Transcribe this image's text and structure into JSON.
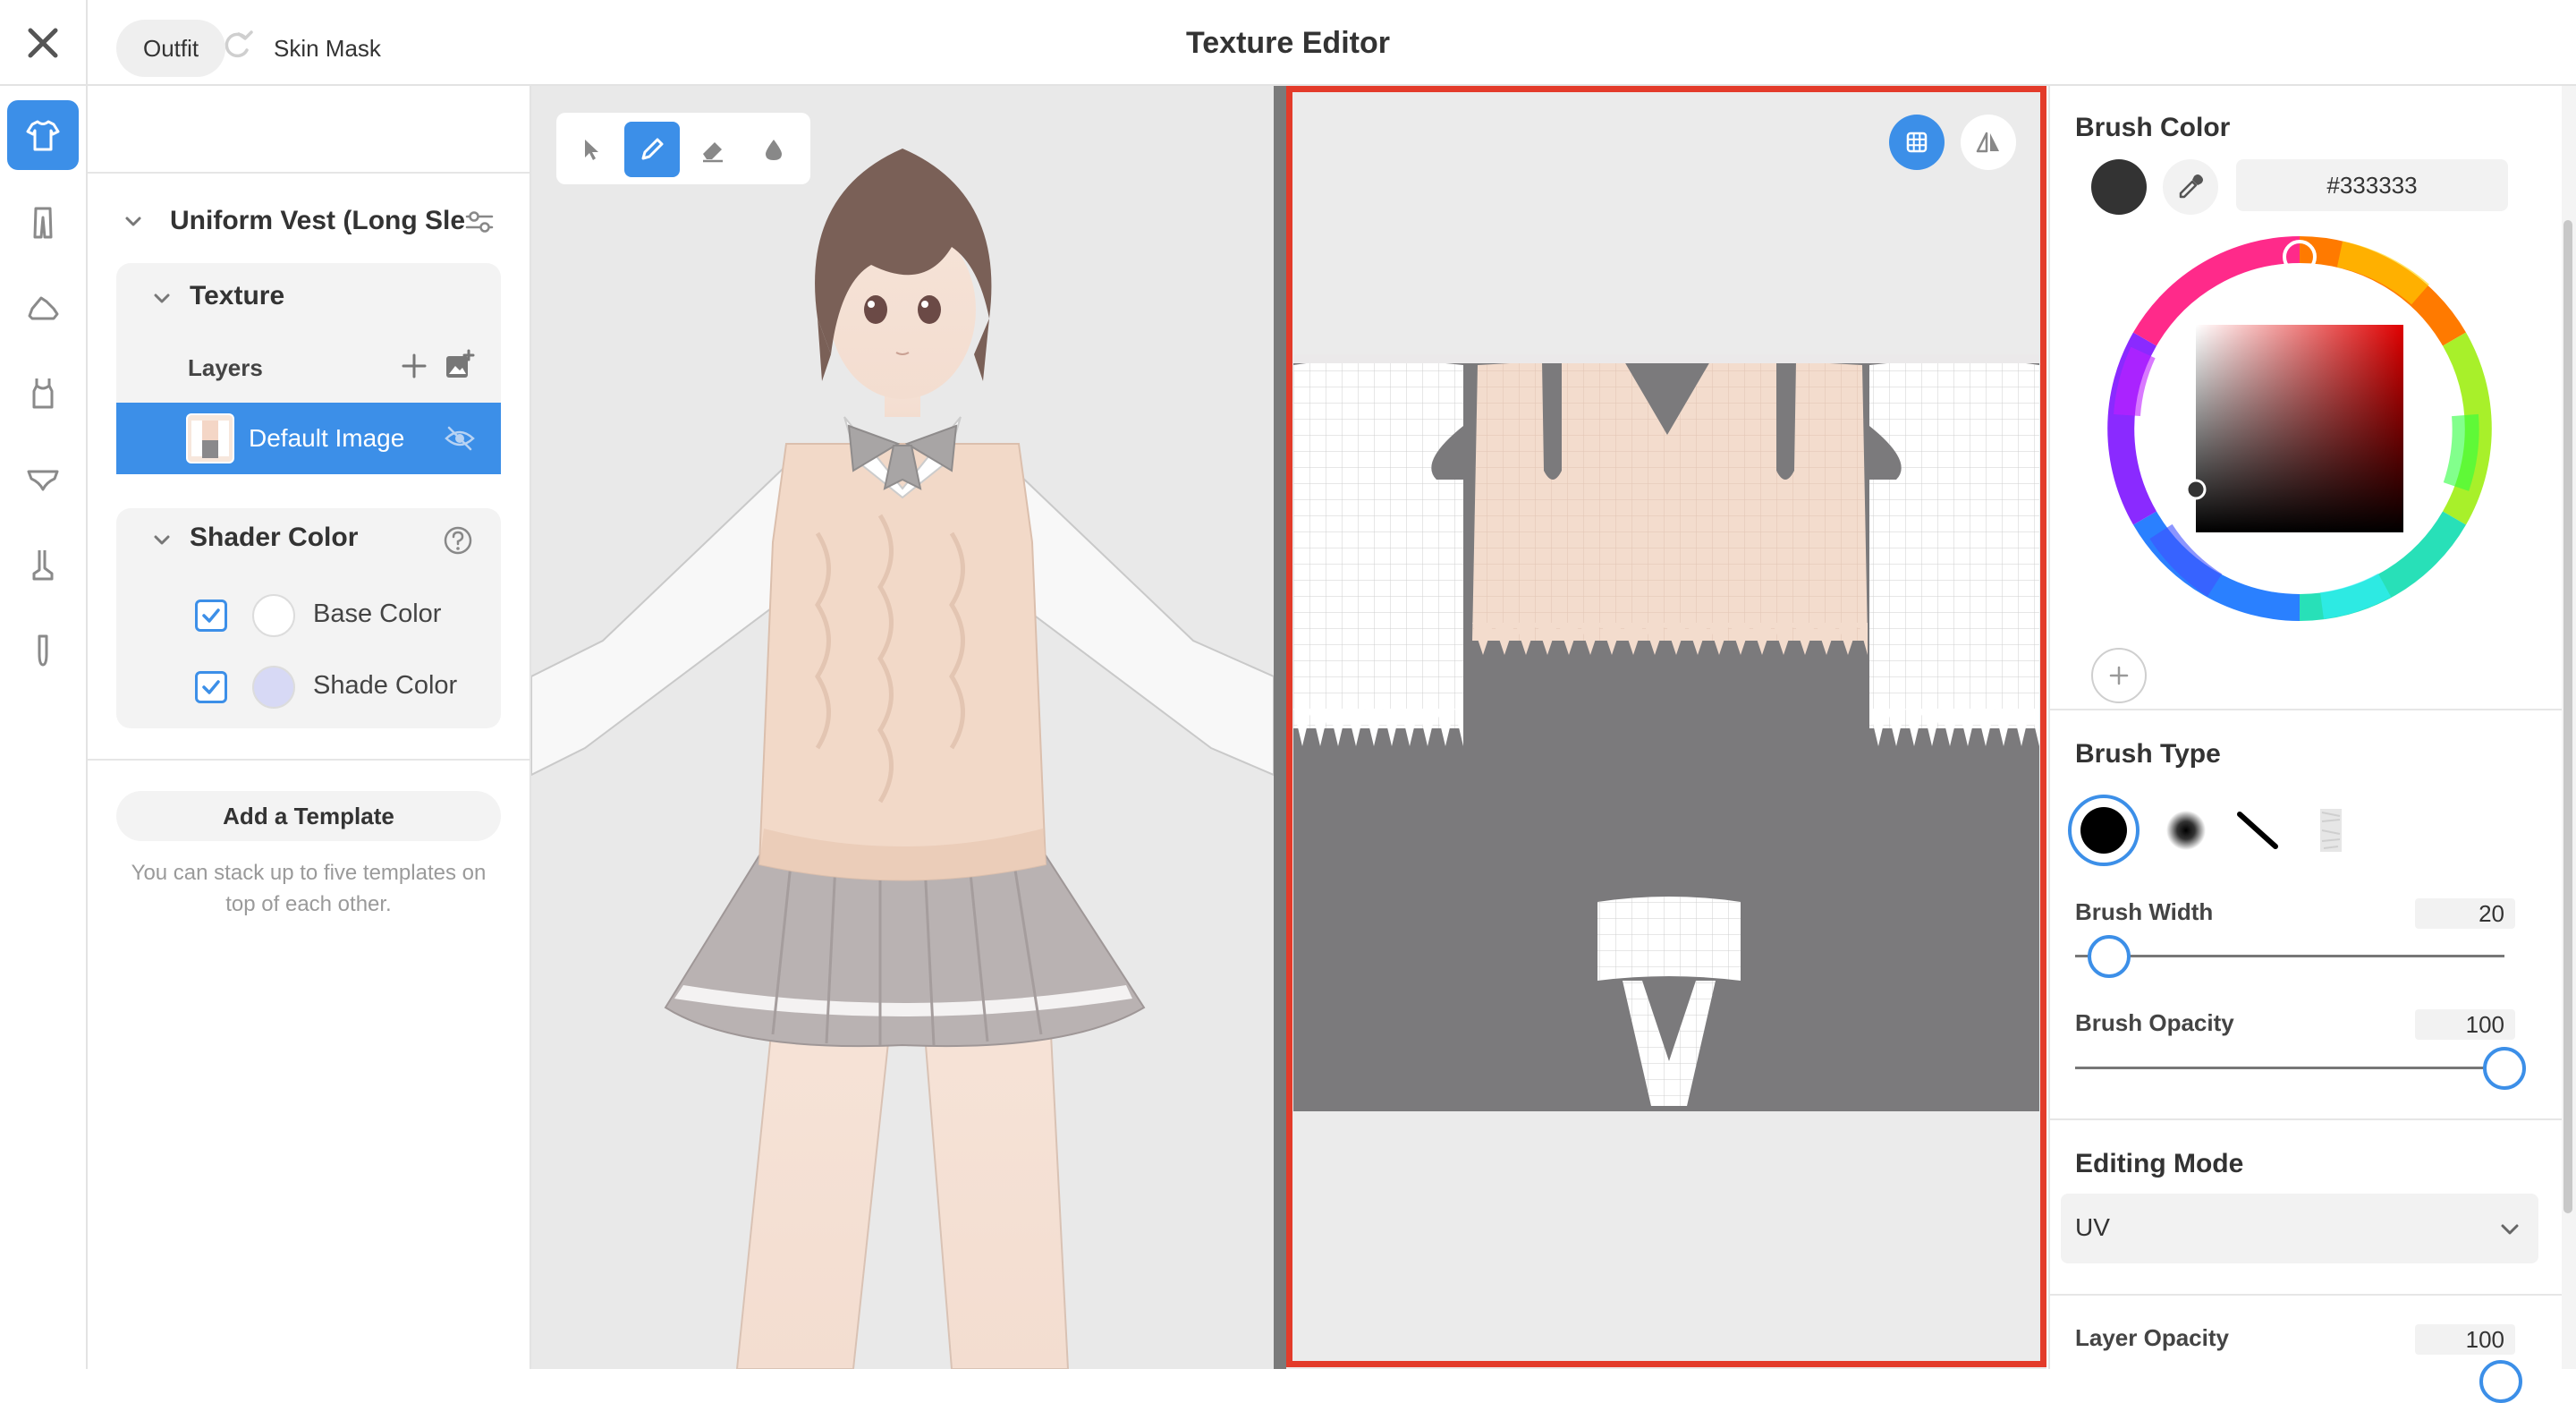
{
  "header": {
    "title": "Texture Editor"
  },
  "left_panel": {
    "tabs": [
      {
        "label": "Outfit"
      },
      {
        "label": "Skin Mask"
      }
    ],
    "outfit_name": "Uniform Vest (Long Slee",
    "texture": {
      "title": "Texture",
      "layers_label": "Layers",
      "layers": [
        {
          "label": "Default Image"
        }
      ]
    },
    "shader": {
      "title": "Shader Color",
      "items": [
        {
          "label": "Base Color",
          "color": "#ffffff"
        },
        {
          "label": "Shade Color",
          "color": "#d7d9f5"
        }
      ]
    },
    "add_template_label": "Add a Template",
    "template_hint": "You can stack up to five templates on top of each other."
  },
  "right_panel": {
    "brush_color": {
      "title": "Brush Color",
      "hex": "#333333"
    },
    "brush_type": {
      "title": "Brush Type"
    },
    "brush_width": {
      "label": "Brush Width",
      "value": "20",
      "fraction": 0.08
    },
    "brush_opacity": {
      "label": "Brush Opacity",
      "value": "100",
      "fraction": 1.0
    },
    "editing_mode": {
      "title": "Editing Mode",
      "value": "UV"
    },
    "layer_opacity": {
      "label": "Layer Opacity",
      "value": "100"
    }
  },
  "colors": {
    "accent": "#3c8fe8",
    "highlight_border": "#e33b2a",
    "uv_background": "#7b7a7c"
  }
}
